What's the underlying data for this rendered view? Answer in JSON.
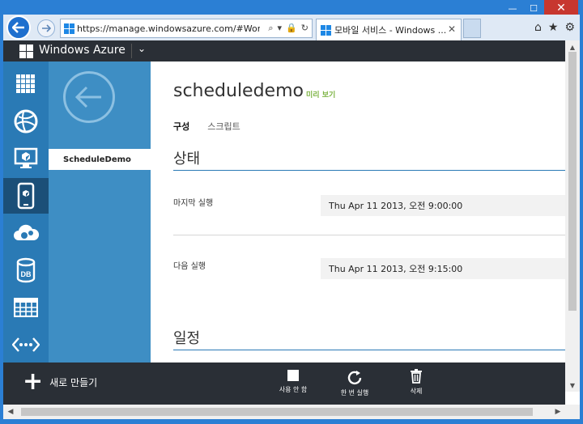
{
  "browser": {
    "url": "https://manage.windowsazure.com/#Workspac",
    "tab_title": "모바일 서비스 - Windows ...",
    "tab_close": "✕",
    "window_controls": [
      "—",
      "☐",
      "✕"
    ]
  },
  "azure": {
    "brand": "Windows Azure",
    "caret": "⌄"
  },
  "nav": {
    "icons": [
      "all-items-icon",
      "websites-icon",
      "virtual-machines-icon",
      "mobile-services-icon",
      "cloud-services-icon",
      "sql-databases-icon",
      "storage-icon",
      "networks-icon"
    ],
    "active_index": 3,
    "db_label": "DB"
  },
  "subnav": {
    "back": "←",
    "item": "ScheduleDemo"
  },
  "page": {
    "title": "scheduledemo",
    "preview": "미리 보기",
    "tabs": [
      "구성",
      "스크립트"
    ],
    "status_heading": "상태",
    "last_run_label": "마지막 실행",
    "last_run_value": "Thu Apr 11 2013, 오전 9:00:00",
    "next_run_label": "다음 실행",
    "next_run_value": "Thu Apr 11 2013, 오전 9:15:00",
    "schedule_heading": "일정"
  },
  "command_bar": {
    "new": "새로 만들기",
    "disable": "사용 안 함",
    "run_once": "한 번 실행",
    "delete": "삭제"
  },
  "colors": {
    "nav_rail": "#2a7ab5",
    "subnav": "#3e8ec4",
    "azure_bar": "#2a2f36",
    "preview_link": "#7cb342"
  }
}
